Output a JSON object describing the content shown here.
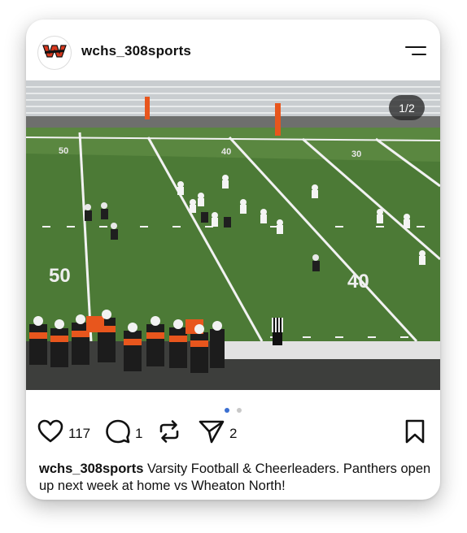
{
  "post": {
    "username": "wchs_308sports",
    "image_counter": "1/2",
    "image_description_icon": "football-game-photo",
    "carousel": {
      "total": 2,
      "active": 1
    },
    "caption": "Varsity Football & Cheerleaders. Panthers open up next week at home vs Wheaton North!",
    "photo_yard_marker": "50"
  },
  "actions": {
    "likes": "117",
    "comments": "1",
    "shares": "2"
  },
  "colors": {
    "field_green": "#4c7a36",
    "team_orange": "#e8561d",
    "accent_active_dot": "#3b6fd1"
  },
  "icons": [
    "logo-icon",
    "menu-icon",
    "heart-icon",
    "comment-icon",
    "repost-icon",
    "send-icon",
    "bookmark-icon"
  ]
}
